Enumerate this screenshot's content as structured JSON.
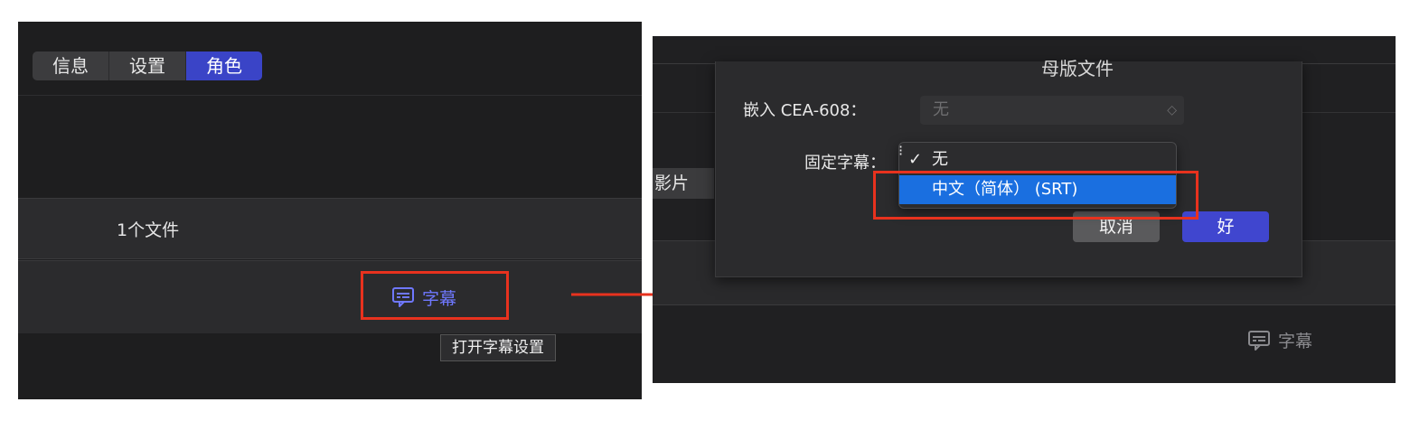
{
  "left_panel": {
    "tabs": [
      {
        "label": "信息",
        "active": false
      },
      {
        "label": "设置",
        "active": false
      },
      {
        "label": "角色",
        "active": true
      }
    ],
    "files_label": "1个文件",
    "caption_button_label": "字幕",
    "tooltip": "打开字幕设置"
  },
  "right_panel": {
    "sheet_title": "母版文件",
    "embed_label": "嵌入 CEA-608：",
    "embed_value": "无",
    "burn_in_label": "固定字幕：",
    "menu": {
      "checkmark": "✓",
      "items": [
        {
          "label": "无",
          "checked": true
        },
        {
          "label": "中文（简体） (SRT)",
          "highlighted": true
        }
      ]
    },
    "cancel_label": "取消",
    "ok_label": "好",
    "movie_label": "影片",
    "caption_label": "字幕"
  },
  "colors": {
    "accent_blue": "#3a44c7",
    "menu_highlight": "#1a6fe0",
    "annotation_red": "#e8321e",
    "caption_blue": "#6f78ff"
  },
  "icons": {
    "caption": "caption-bubble-icon",
    "arrow": "arrow-right-icon",
    "chevron": "chevron-updown-icon"
  }
}
